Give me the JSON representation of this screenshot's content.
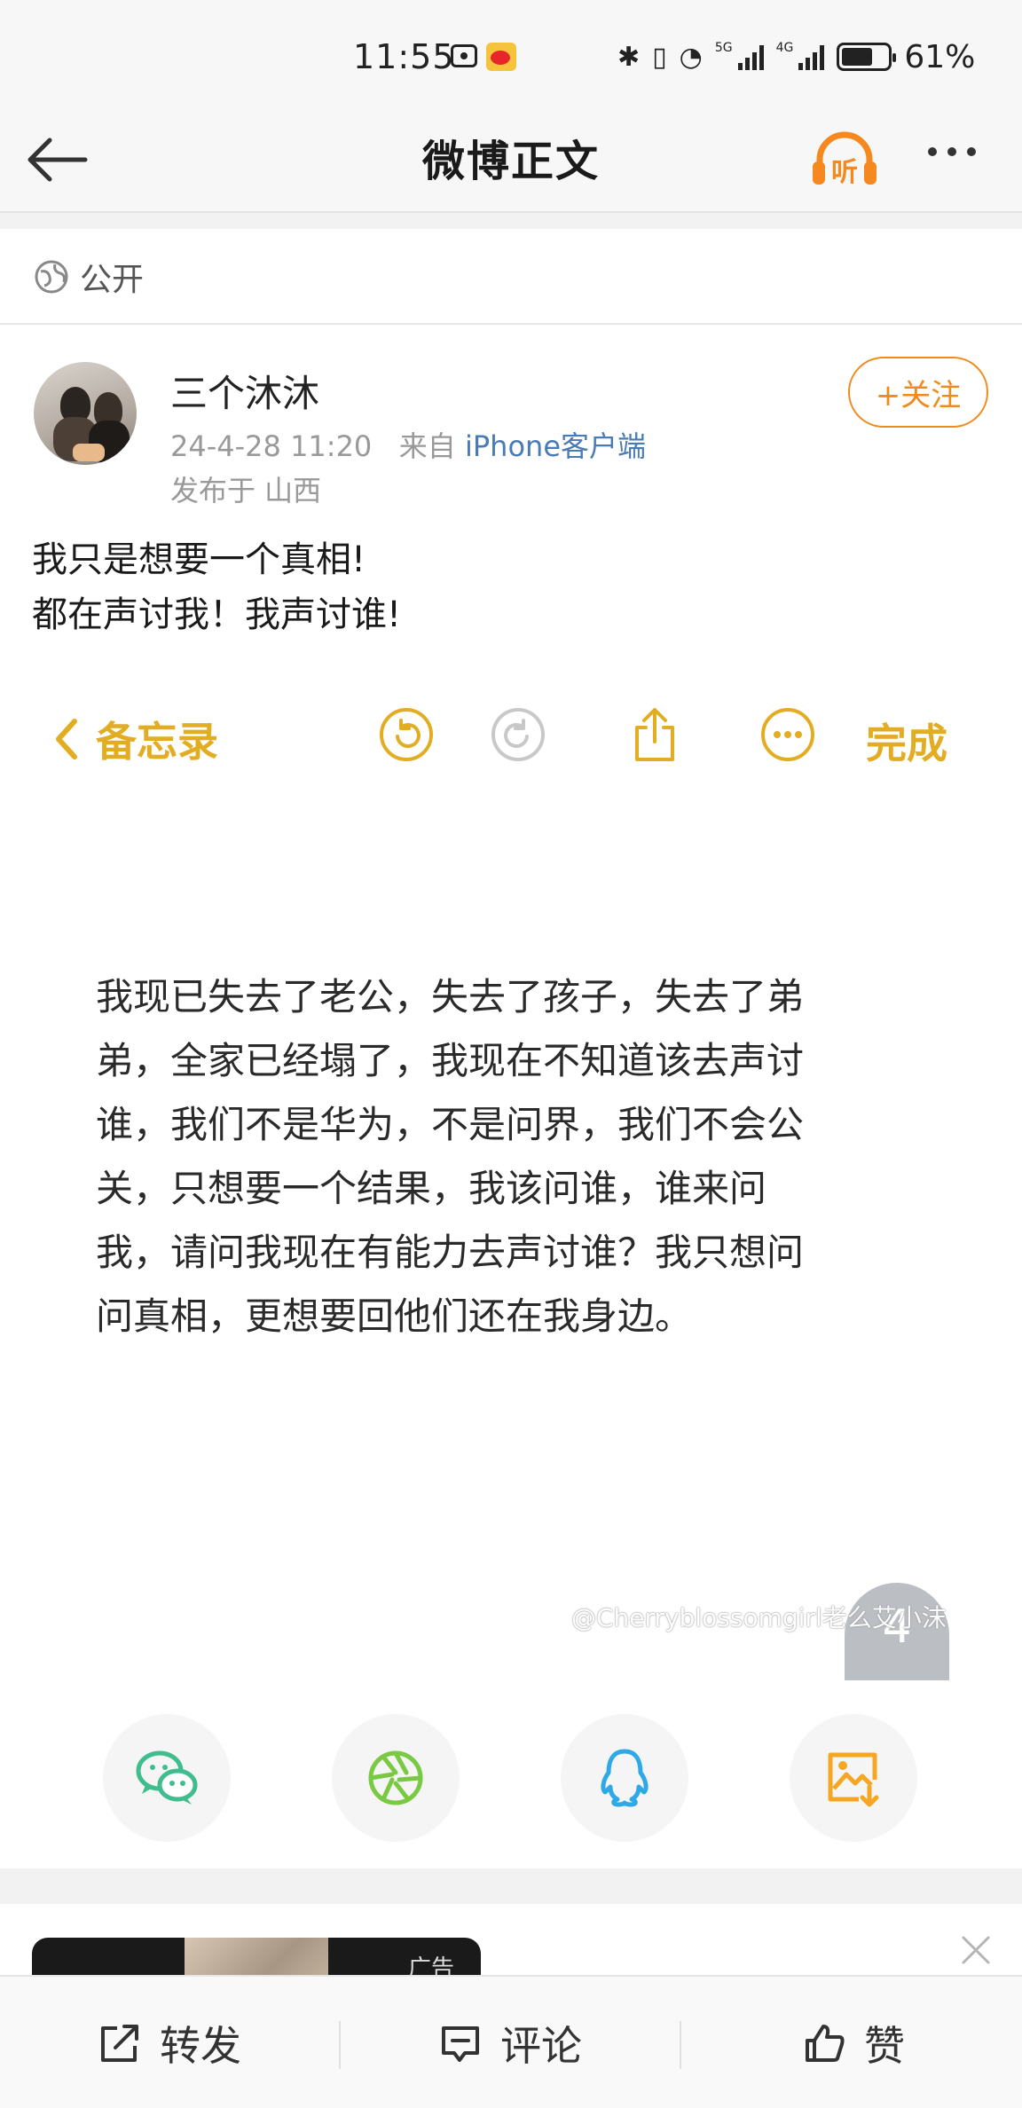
{
  "status_bar": {
    "time": "11:55",
    "tag_5g": "5G",
    "tag_4g": "4G",
    "battery_percent": "61%",
    "battery_level": 0.61
  },
  "nav": {
    "title": "微博正文",
    "listen_label": "听"
  },
  "visibility": {
    "label": "公开"
  },
  "post": {
    "author": "三个沐沐",
    "timestamp": "24-4-28 11:20",
    "source_prefix": "来自",
    "source": "iPhone客户端",
    "location": "发布于 山西",
    "follow_label": "+关注",
    "text_line1": "我只是想要一个真相!",
    "text_line2": "都在声讨我！我声讨谁!"
  },
  "embedded_notes": {
    "back_label": "备忘录",
    "done_label": "完成",
    "lines": [
      "我现已失去了老公，失去了孩子，失去了弟",
      "弟，全家已经塌了，我现在不知道该去声讨",
      "谁，我们不是华为，不是问界，我们不会公",
      "关，只想要一个结果，我该问谁，谁来问",
      "我，请问我现在有能力去声讨谁？我只想问",
      "问真相，更想要回他们还在我身边。"
    ],
    "page_number": "4",
    "watermark": "@Cherryblossomgirl老么艾小沫"
  },
  "share": {
    "wechat_color": "#3fbd8f",
    "moments_color": "#7ac943",
    "qq_color": "#2fa9e6",
    "save_color": "#f5a623"
  },
  "ad": {
    "label": "广告"
  },
  "toolbar": {
    "repost_label": "转发",
    "comment_label": "评论",
    "like_label": "赞"
  }
}
